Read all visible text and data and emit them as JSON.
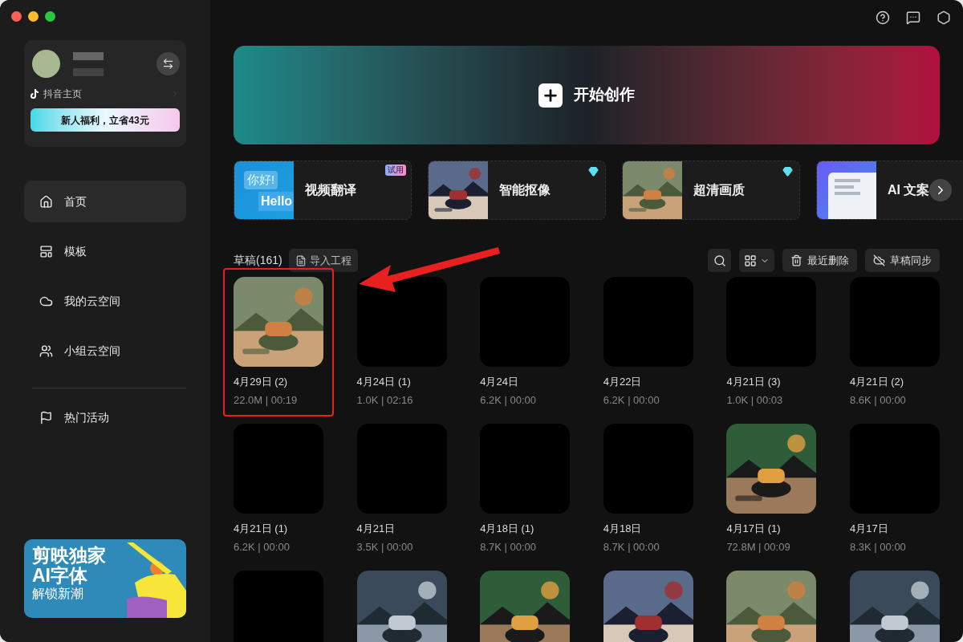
{
  "account": {
    "douyin_link": "抖音主页",
    "promo": "新人福利，立省43元"
  },
  "nav": [
    {
      "label": "首页",
      "selected": true
    },
    {
      "label": "模板",
      "selected": false
    },
    {
      "label": "我的云空间",
      "selected": false
    },
    {
      "label": "小组云空间",
      "selected": false
    },
    {
      "label": "热门活动",
      "selected": false
    }
  ],
  "sidebar_banner": {
    "lines": [
      "剪映独家",
      "AI字体",
      "解锁新潮"
    ]
  },
  "create_banner": {
    "label": "开始创作"
  },
  "features": [
    {
      "title": "视频翻译",
      "badge": "试用",
      "premium": false,
      "kind": "translate",
      "thumb_texts": [
        "你好!",
        "Hello"
      ]
    },
    {
      "title": "智能抠像",
      "premium": true,
      "kind": "picture"
    },
    {
      "title": "超清画质",
      "premium": true,
      "kind": "picture"
    },
    {
      "title": "AI 文案",
      "premium": false,
      "kind": "doc"
    }
  ],
  "drafts_header": {
    "title": "草稿(161)",
    "import": "导入工程",
    "recent_delete": "最近删除",
    "sync": "草稿同步"
  },
  "drafts": [
    {
      "title": "4月29日 (2)",
      "meta": "22.0M | 00:19",
      "kind": "picture",
      "highlighted": true
    },
    {
      "title": "4月24日 (1)",
      "meta": "1.0K | 02:16",
      "kind": "blank",
      "highlighted": false
    },
    {
      "title": "4月24日",
      "meta": "6.2K | 00:00",
      "kind": "blank",
      "highlighted": false
    },
    {
      "title": "4月22日",
      "meta": "6.2K | 00:00",
      "kind": "blank",
      "highlighted": false
    },
    {
      "title": "4月21日 (3)",
      "meta": "1.0K | 00:03",
      "kind": "blank",
      "highlighted": false
    },
    {
      "title": "4月21日 (2)",
      "meta": "8.6K | 00:00",
      "kind": "blank",
      "highlighted": false
    },
    {
      "title": "4月21日 (1)",
      "meta": "6.2K | 00:00",
      "kind": "blank",
      "highlighted": false
    },
    {
      "title": "4月21日",
      "meta": "3.5K | 00:00",
      "kind": "blank",
      "highlighted": false
    },
    {
      "title": "4月18日 (1)",
      "meta": "8.7K | 00:00",
      "kind": "blank",
      "highlighted": false
    },
    {
      "title": "4月18日",
      "meta": "8.7K | 00:00",
      "kind": "blank",
      "highlighted": false
    },
    {
      "title": "4月17日 (1)",
      "meta": "72.8M | 00:09",
      "kind": "picture",
      "highlighted": false
    },
    {
      "title": "4月17日",
      "meta": "8.3K | 00:00",
      "kind": "blank",
      "highlighted": false
    },
    {
      "kind": "blank",
      "highlighted": false
    },
    {
      "kind": "picture",
      "highlighted": false
    },
    {
      "kind": "picture",
      "highlighted": false
    },
    {
      "kind": "picture",
      "highlighted": false
    },
    {
      "kind": "picture",
      "highlighted": false
    },
    {
      "kind": "picture",
      "highlighted": false
    }
  ]
}
